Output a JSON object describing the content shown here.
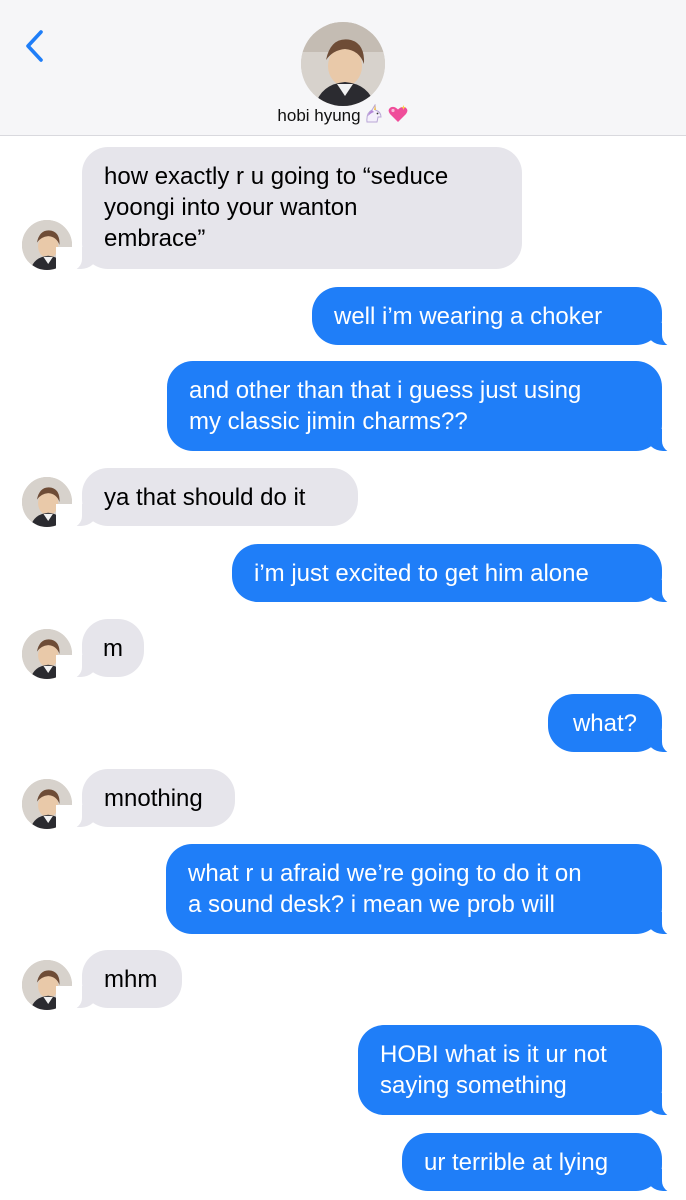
{
  "header": {
    "contact_name": "hobi hyung",
    "emoji_icons": [
      "unicorn-icon",
      "sparkling-heart-icon"
    ],
    "back_icon": "chevron-left-icon"
  },
  "colors": {
    "sent_bubble": "#1f7ef8",
    "received_bubble": "#e6e5eb",
    "header_bg": "#f6f6f8",
    "accent": "#1f7ef8"
  },
  "messages": [
    {
      "from": "them",
      "lines": [
        "how exactly r u going to “seduce",
        "yoongi into your wanton",
        "embrace”"
      ]
    },
    {
      "from": "me",
      "lines": [
        "well i’m wearing a choker"
      ]
    },
    {
      "from": "me",
      "lines": [
        "and other than that i guess just using",
        "my classic jimin charms??"
      ]
    },
    {
      "from": "them",
      "lines": [
        "ya that should do it"
      ]
    },
    {
      "from": "me",
      "lines": [
        "i’m just excited to get him alone"
      ]
    },
    {
      "from": "them",
      "lines": [
        "m"
      ]
    },
    {
      "from": "me",
      "lines": [
        "what?"
      ]
    },
    {
      "from": "them",
      "lines": [
        "mnothing"
      ]
    },
    {
      "from": "me",
      "lines": [
        "what r u afraid we’re going to do it on",
        "a sound desk? i mean we prob will"
      ]
    },
    {
      "from": "them",
      "lines": [
        "mhm"
      ]
    },
    {
      "from": "me",
      "lines": [
        "HOBI what is it ur not",
        "saying something"
      ]
    },
    {
      "from": "me",
      "lines": [
        "ur terrible at lying"
      ]
    }
  ]
}
